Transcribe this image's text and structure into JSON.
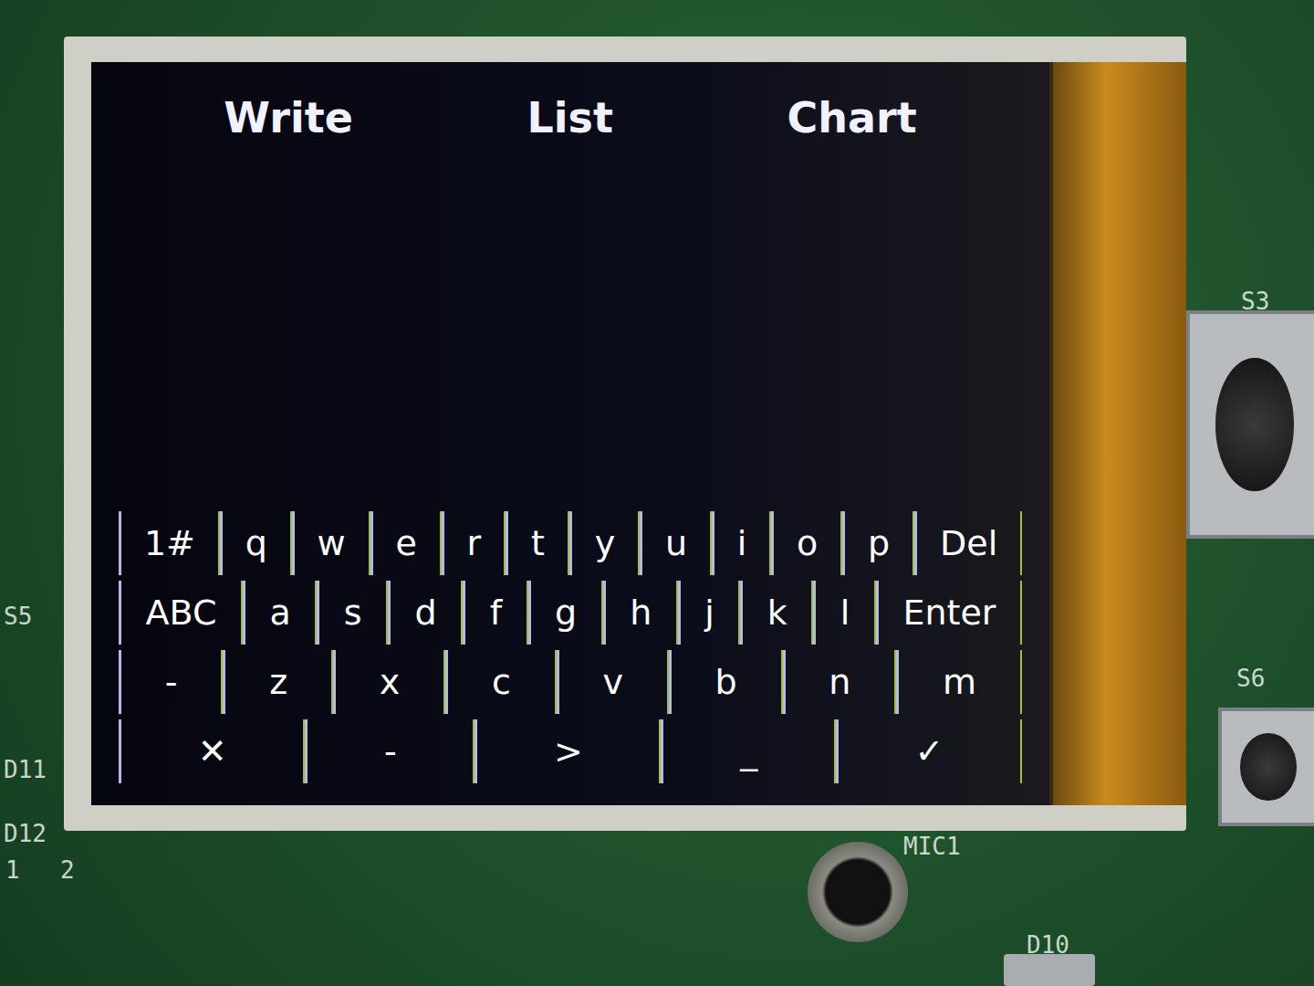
{
  "screen": {
    "tabs": [
      {
        "label": "Write"
      },
      {
        "label": "List"
      },
      {
        "label": "Chart"
      }
    ],
    "keyboard": {
      "rows": [
        [
          "1#",
          "q",
          "w",
          "e",
          "r",
          "t",
          "y",
          "u",
          "i",
          "o",
          "p",
          "Del"
        ],
        [
          "ABC",
          "a",
          "s",
          "d",
          "f",
          "g",
          "h",
          "j",
          "k",
          "l",
          "Enter"
        ],
        [
          "-",
          "z",
          "x",
          "c",
          "v",
          "b",
          "n",
          "m"
        ],
        [
          "✕",
          "-",
          ">",
          "_",
          "✓"
        ]
      ]
    }
  },
  "board": {
    "labels": [
      "S3",
      "S6",
      "MIC1",
      "D10",
      "S5",
      "D11",
      "D12",
      "1",
      "2"
    ]
  }
}
